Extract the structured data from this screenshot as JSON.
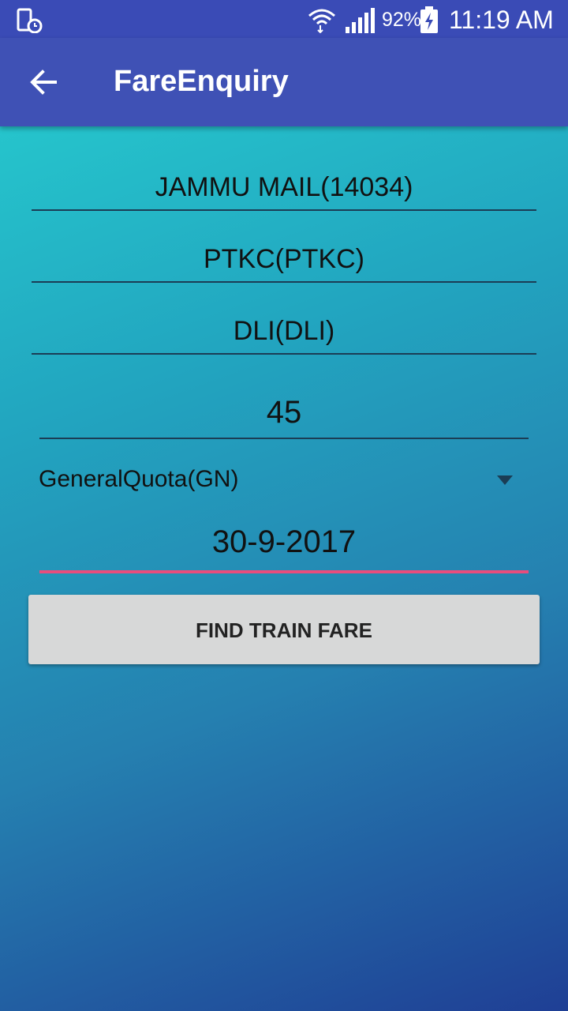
{
  "status_bar": {
    "battery_percent": "92%",
    "time": "11:19 AM",
    "icons": [
      "device-clock-icon",
      "wifi-icon",
      "signal-icon",
      "battery-charging-icon"
    ]
  },
  "app_bar": {
    "title": "FareEnquiry",
    "back_icon": "back-arrow-icon"
  },
  "form": {
    "train": "JAMMU MAIL(14034)",
    "from_station": "PTKC(PTKC)",
    "to_station": "DLI(DLI)",
    "age": "45",
    "quota": "GeneralQuota(GN)",
    "date": "30-9-2017",
    "submit_label": "FIND TRAIN FARE"
  },
  "colors": {
    "app_bar": "#3f51b5",
    "status_bar": "#3a4bb6",
    "accent_underline": "#e84d7d",
    "button": "#d7d8d8"
  }
}
